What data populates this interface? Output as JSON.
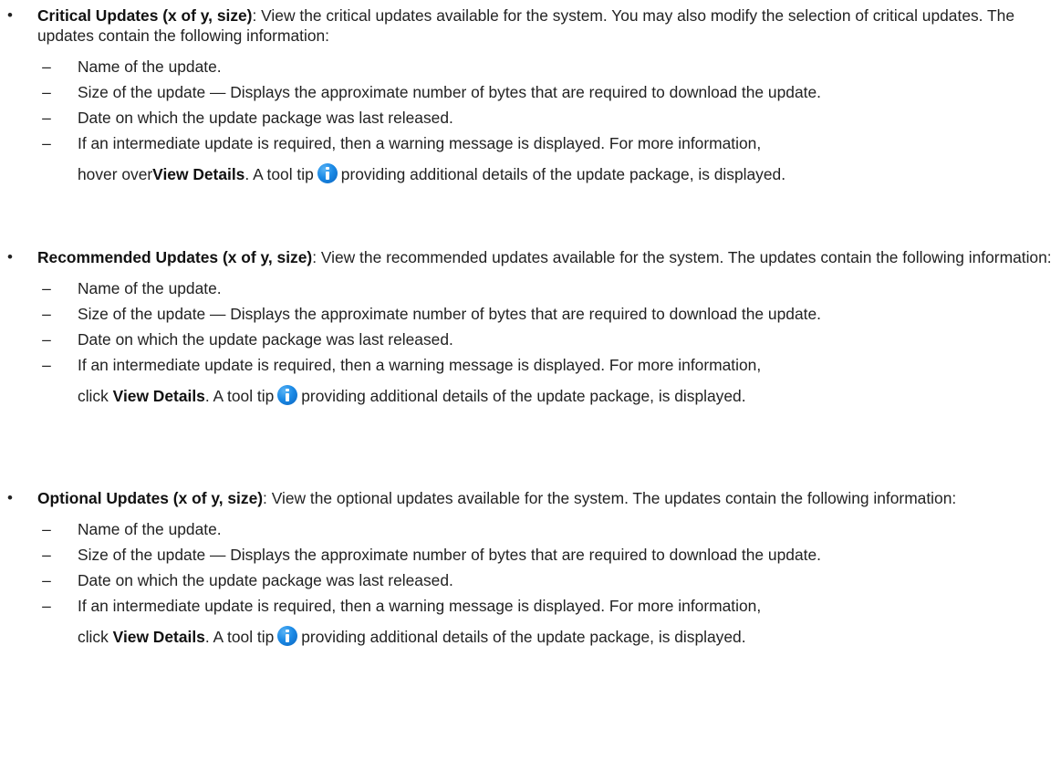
{
  "sections": [
    {
      "bullet": "•",
      "title": "Critical Updates (x of y, size)",
      "description": ": View the critical updates available for the system. You may also modify the selection of critical updates. The updates contain the following information:",
      "items": {
        "name": "Name of the update.",
        "size": "Size of the update — Displays the approximate number of bytes that are required to download the update.",
        "date": "Date on which the update package was last released.",
        "warning_line1": "If an intermediate update is required, then a warning message is displayed. For more information,",
        "warning_pre": "hover over",
        "warning_link": "View Details",
        "warning_mid": ". A tool tip",
        "warning_post": "providing additional details of the update package, is displayed."
      }
    },
    {
      "bullet": "•",
      "title": "Recommended Updates (x of y, size)",
      "description": ": View the recommended updates available for the system. The updates contain the following information:",
      "items": {
        "name": "Name of the update.",
        "size": "Size of the update — Displays the approximate number of bytes that are required to download the update.",
        "date": "Date on which the update package was last released.",
        "warning_line1": "If an intermediate update is required, then a warning message is displayed. For more information,",
        "warning_pre": "click ",
        "warning_link": "View Details",
        "warning_mid": ". A tool tip",
        "warning_post": "providing additional details of the update package, is displayed."
      }
    },
    {
      "bullet": "•",
      "title": "Optional Updates (x of y, size)",
      "description": ": View the optional updates available for the system. The updates contain the following information:",
      "items": {
        "name": "Name of the update.",
        "size": "Size of the update — Displays the approximate number of bytes that are required to download the update.",
        "date": "Date on which the update package was last released.",
        "warning_line1": "If an intermediate update is required, then a warning message is displayed. For more information,",
        "warning_pre": "click ",
        "warning_link": "View Details",
        "warning_mid": ". A tool tip",
        "warning_post": "providing additional details of the update package, is displayed."
      }
    }
  ],
  "dash": "–",
  "icons": {
    "tooltip": "info-icon"
  },
  "colors": {
    "info_icon": "#1b8ae6"
  }
}
